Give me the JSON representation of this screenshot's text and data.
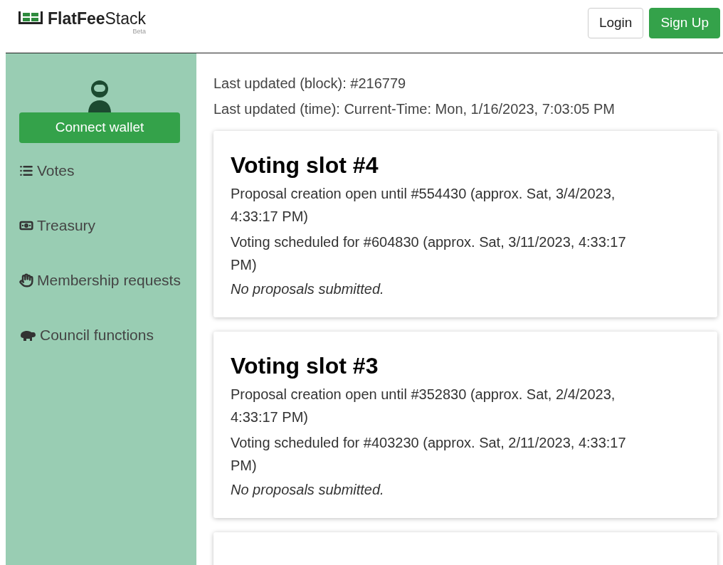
{
  "header": {
    "logo": {
      "bold": "FlatFee",
      "light": "Stack",
      "badge": "Beta"
    },
    "buttons": [
      {
        "label": "Login",
        "kind": "outline"
      },
      {
        "label": "Sign Up",
        "kind": "primary"
      }
    ]
  },
  "sidebar": {
    "connect_button": "Connect wallet",
    "items": [
      {
        "label": "Votes",
        "kind": "list"
      },
      {
        "label": "Treasury",
        "kind": "money"
      },
      {
        "label": "Membership requests",
        "kind": "hand"
      },
      {
        "label": "Council functions",
        "kind": "animal"
      }
    ]
  },
  "status": [
    "Last updated (block): #216779",
    "Last updated (time): Current-Time: Mon, 1/16/2023, 7:03:05 PM"
  ],
  "slots": [
    {
      "title": "Voting slot #4",
      "lines": [
        "Proposal creation open until #554430 (approx. Sat, 3/4/2023, 4:33:17 PM)",
        "Voting scheduled for #604830 (approx. Sat, 3/11/2023, 4:33:17 PM)"
      ],
      "note": "No proposals submitted."
    },
    {
      "title": "Voting slot #3",
      "lines": [
        "Proposal creation open until #352830 (approx. Sat, 2/4/2023, 4:33:17 PM)",
        "Voting scheduled for #403230 (approx. Sat, 2/11/2023, 4:33:17 PM)"
      ],
      "note": "No proposals submitted."
    },
    {
      "kind": "cut"
    }
  ]
}
